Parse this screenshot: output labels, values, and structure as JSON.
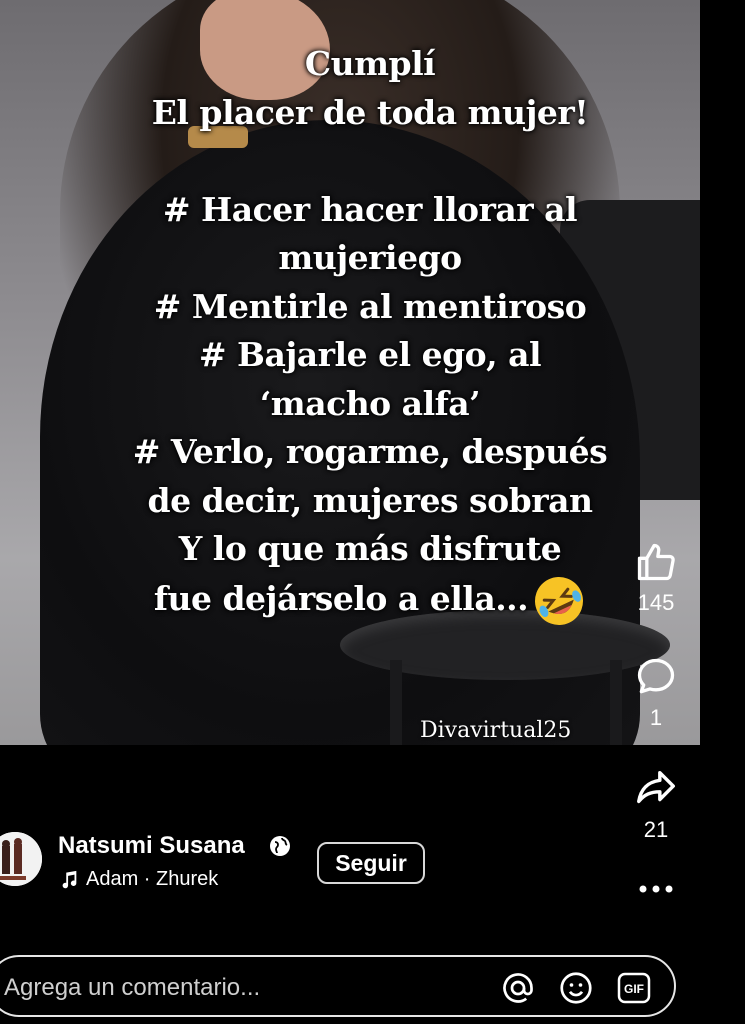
{
  "post": {
    "quote_lines": [
      "Cumplí",
      "El placer de toda mujer!",
      "",
      "# Hacer hacer llorar al",
      "mujeriego",
      "# Mentirle al mentiroso",
      "# Bajarle el ego,  al",
      "‘macho alfa’",
      "# Verlo, rogarme, después",
      "de decir, mujeres sobran",
      "Y lo que más disfrute",
      "fue dejárselo a ella..."
    ],
    "emoji": "rolling-on-floor-laughing-emoji",
    "watermark": "Divavirtual25"
  },
  "actions": {
    "like_icon": "thumbs-up-icon",
    "like_count": "145",
    "comment_icon": "comment-bubble-icon",
    "comment_count": "1",
    "share_icon": "share-arrow-icon",
    "share_count": "21",
    "more_icon": "more-dots-icon"
  },
  "author": {
    "name": "Natsumi Susana",
    "privacy_icon": "globe-icon",
    "audio_icon": "music-note-icon",
    "audio": "Adam · Zhurek",
    "follow_label": "Seguir"
  },
  "comment_bar": {
    "placeholder": "Agrega un comentario...",
    "mention_icon": "at-mention-icon",
    "emoji_icon": "smiley-icon",
    "gif_icon": "gif-icon",
    "gif_label": "GIF"
  }
}
